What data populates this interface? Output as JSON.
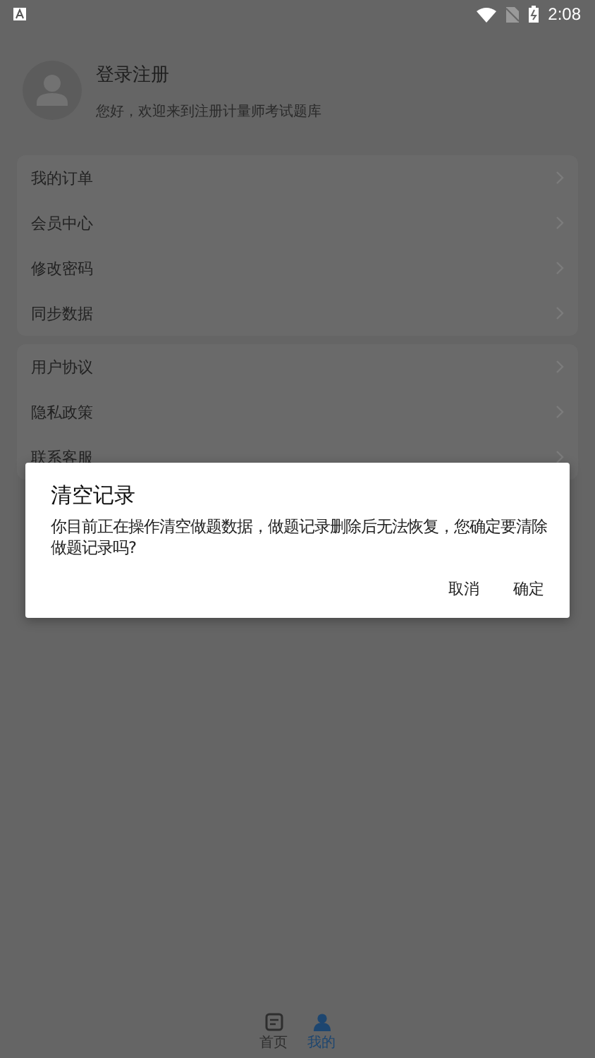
{
  "status_bar": {
    "time": "2:08"
  },
  "profile": {
    "title": "登录注册",
    "subtitle": "您好，欢迎来到注册计量师考试题库"
  },
  "menu_groups": [
    {
      "items": [
        "我的订单",
        "会员中心",
        "修改密码",
        "同步数据"
      ]
    },
    {
      "items": [
        "用户协议",
        "隐私政策",
        "联系客服"
      ]
    }
  ],
  "dialog": {
    "title": "清空记录",
    "message": "你目前正在操作清空做题数据，做题记录删除后无法恢复，您确定要清除做题记录吗?",
    "buttons": [
      "取消",
      "确定"
    ]
  },
  "bottom_nav": [
    {
      "label": "首页",
      "selected": false
    },
    {
      "label": "我的",
      "selected": true
    }
  ]
}
